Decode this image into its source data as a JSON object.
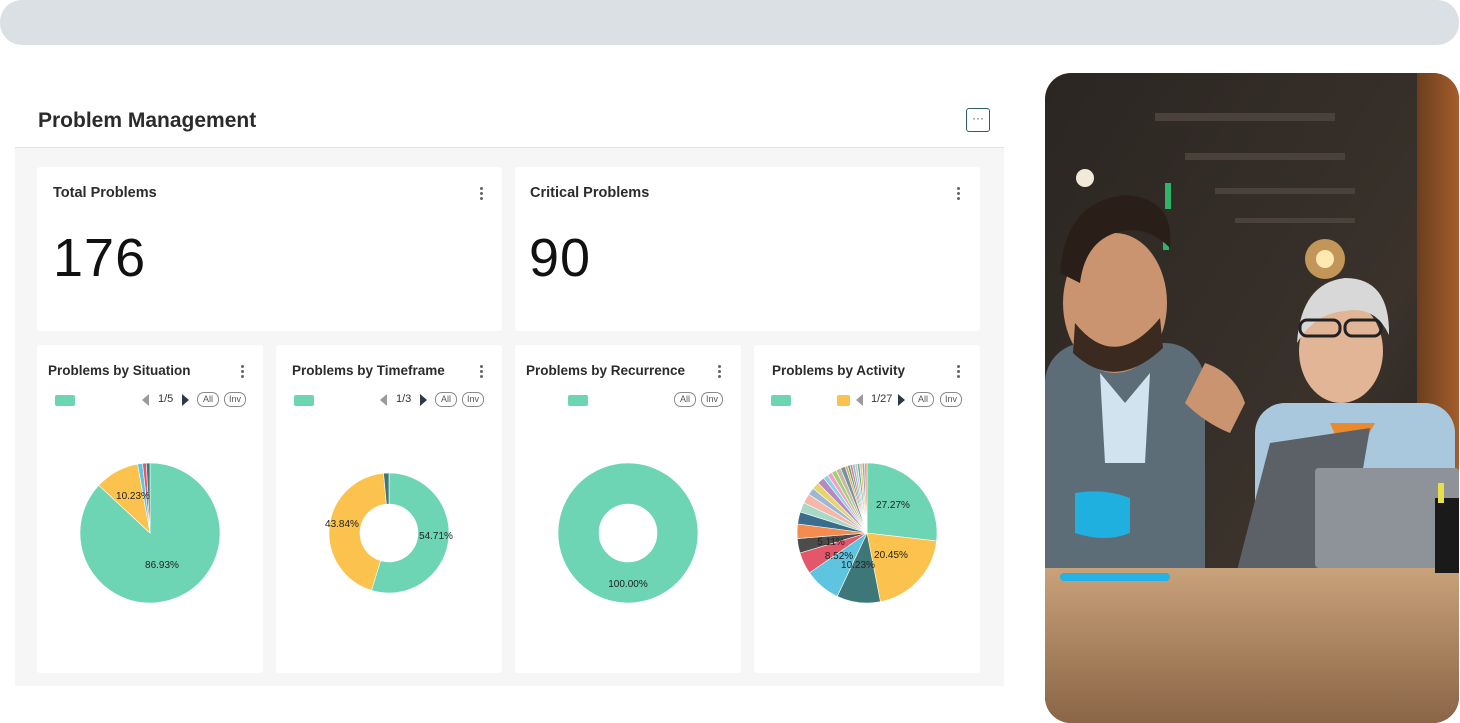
{
  "header": {
    "title": "Problem Management",
    "more_label": "···"
  },
  "kpis": [
    {
      "title": "Total Problems",
      "value": "176"
    },
    {
      "title": "Critical Problems",
      "value": "90"
    }
  ],
  "colors": {
    "teal": "#6dd4b4",
    "yellow": "#fbc24d",
    "dark_teal": "#3e7778",
    "sky": "#5ec4e0",
    "red": "#e4576a",
    "panel": "#f6f6f6"
  },
  "chart_data": [
    {
      "type": "pie",
      "title": "Problems by Situation",
      "pager": "1/5",
      "controls": [
        "All",
        "Inv"
      ],
      "slices": [
        {
          "label": "86.93%",
          "value": 86.93,
          "color": "#6dd4b4"
        },
        {
          "label": "10.23%",
          "value": 10.23,
          "color": "#fbc24d"
        },
        {
          "label": "",
          "value": 1.14,
          "color": "#5ec4e0"
        },
        {
          "label": "",
          "value": 0.85,
          "color": "#e4576a"
        },
        {
          "label": "",
          "value": 0.85,
          "color": "#3e7778"
        }
      ]
    },
    {
      "type": "donut",
      "title": "Problems by Timeframe",
      "pager": "1/3",
      "controls": [
        "All",
        "Inv"
      ],
      "slices": [
        {
          "label": "54.71%",
          "value": 54.71,
          "color": "#6dd4b4"
        },
        {
          "label": "43.84%",
          "value": 43.84,
          "color": "#fbc24d"
        },
        {
          "label": "",
          "value": 1.45,
          "color": "#3e7778"
        }
      ]
    },
    {
      "type": "donut",
      "title": "Problems by Recurrence",
      "pager": "",
      "controls": [
        "All",
        "Inv"
      ],
      "slices": [
        {
          "label": "100.00%",
          "value": 100.0,
          "color": "#6dd4b4"
        }
      ]
    },
    {
      "type": "pie",
      "title": "Problems by Activity",
      "pager": "1/27",
      "controls": [
        "All",
        "Inv"
      ],
      "slices": [
        {
          "label": "27.27%",
          "value": 27.27,
          "color": "#6dd4b4"
        },
        {
          "label": "20.45%",
          "value": 20.45,
          "color": "#fbc24d"
        },
        {
          "label": "10.23%",
          "value": 10.23,
          "color": "#3e7778"
        },
        {
          "label": "8.52%",
          "value": 8.52,
          "color": "#5ec4e0"
        },
        {
          "label": "5.11%",
          "value": 5.11,
          "color": "#e4576a"
        },
        {
          "label": "",
          "value": 3.4,
          "color": "#4c4c4c"
        },
        {
          "label": "",
          "value": 3.4,
          "color": "#f48c50"
        },
        {
          "label": "",
          "value": 2.84,
          "color": "#3a6d8c"
        },
        {
          "label": "",
          "value": 2.27,
          "color": "#a7d9c6"
        },
        {
          "label": "",
          "value": 2.27,
          "color": "#f4b7a8"
        },
        {
          "label": "",
          "value": 1.7,
          "color": "#9fb7d4"
        },
        {
          "label": "",
          "value": 1.7,
          "color": "#e7d46a"
        },
        {
          "label": "",
          "value": 1.7,
          "color": "#b48ac4"
        },
        {
          "label": "",
          "value": 1.14,
          "color": "#8fd0e6"
        },
        {
          "label": "",
          "value": 1.14,
          "color": "#f1a3c0"
        },
        {
          "label": "",
          "value": 1.14,
          "color": "#9ed27a"
        },
        {
          "label": "",
          "value": 1.14,
          "color": "#c9b8a0"
        },
        {
          "label": "",
          "value": 1.14,
          "color": "#7b8fa6"
        },
        {
          "label": "",
          "value": 0.57,
          "color": "#d4b14c"
        },
        {
          "label": "",
          "value": 0.57,
          "color": "#5aa08a"
        },
        {
          "label": "",
          "value": 0.57,
          "color": "#e07b7b"
        },
        {
          "label": "",
          "value": 0.57,
          "color": "#8dbbd9"
        },
        {
          "label": "",
          "value": 0.57,
          "color": "#c6c6c6"
        },
        {
          "label": "",
          "value": 0.57,
          "color": "#6ab4a0"
        },
        {
          "label": "",
          "value": 0.57,
          "color": "#f0c674"
        },
        {
          "label": "",
          "value": 0.57,
          "color": "#a0a0d0"
        },
        {
          "label": "",
          "value": 0.57,
          "color": "#e8a060"
        }
      ]
    }
  ]
}
